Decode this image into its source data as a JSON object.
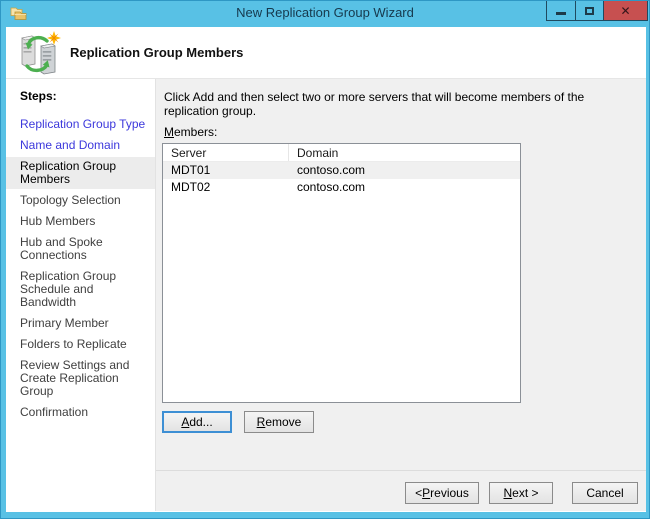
{
  "window": {
    "title": "New Replication Group Wizard",
    "icons": {
      "app": "replication-folders-icon",
      "minimize": "minimize-icon",
      "maximize": "maximize-icon",
      "close": "close-icon"
    }
  },
  "header": {
    "title": "Replication Group Members",
    "icon": "replication-servers-new-icon"
  },
  "sidebar": {
    "heading": "Steps:",
    "steps": [
      {
        "label": "Replication Group Type",
        "state": "completed"
      },
      {
        "label": "Name and Domain",
        "state": "completed"
      },
      {
        "label": "Replication Group Members",
        "state": "current"
      },
      {
        "label": "Topology Selection",
        "state": "upcoming"
      },
      {
        "label": "Hub Members",
        "state": "upcoming"
      },
      {
        "label": "Hub and Spoke Connections",
        "state": "upcoming"
      },
      {
        "label": "Replication Group Schedule and Bandwidth",
        "state": "upcoming"
      },
      {
        "label": "Primary Member",
        "state": "upcoming"
      },
      {
        "label": "Folders to Replicate",
        "state": "upcoming"
      },
      {
        "label": "Review Settings and Create Replication Group",
        "state": "upcoming"
      },
      {
        "label": "Confirmation",
        "state": "upcoming"
      }
    ]
  },
  "main": {
    "instruction": "Click Add and then select two or more servers that will become members of the replication group.",
    "members_label": {
      "key": "M",
      "rest": "embers:"
    },
    "table": {
      "columns": [
        "Server",
        "Domain"
      ],
      "rows": [
        {
          "server": "MDT01",
          "domain": "contoso.com",
          "selected": true
        },
        {
          "server": "MDT02",
          "domain": "contoso.com",
          "selected": false
        }
      ]
    },
    "buttons": {
      "add": {
        "key": "A",
        "rest": "dd..."
      },
      "remove": {
        "key": "R",
        "rest": "emove"
      }
    }
  },
  "footer": {
    "previous": {
      "pre": "< ",
      "key": "P",
      "rest": "revious"
    },
    "next": {
      "key": "N",
      "rest": "ext >"
    },
    "cancel": {
      "label": "Cancel"
    }
  },
  "colors": {
    "titlebar": "#58c1e5",
    "close_button": "#c75050",
    "step_link": "#3c38dc",
    "current_step_highlight": "#ececec",
    "main_background": "#f0f0f0",
    "selected_row": "#f0f0f0"
  }
}
